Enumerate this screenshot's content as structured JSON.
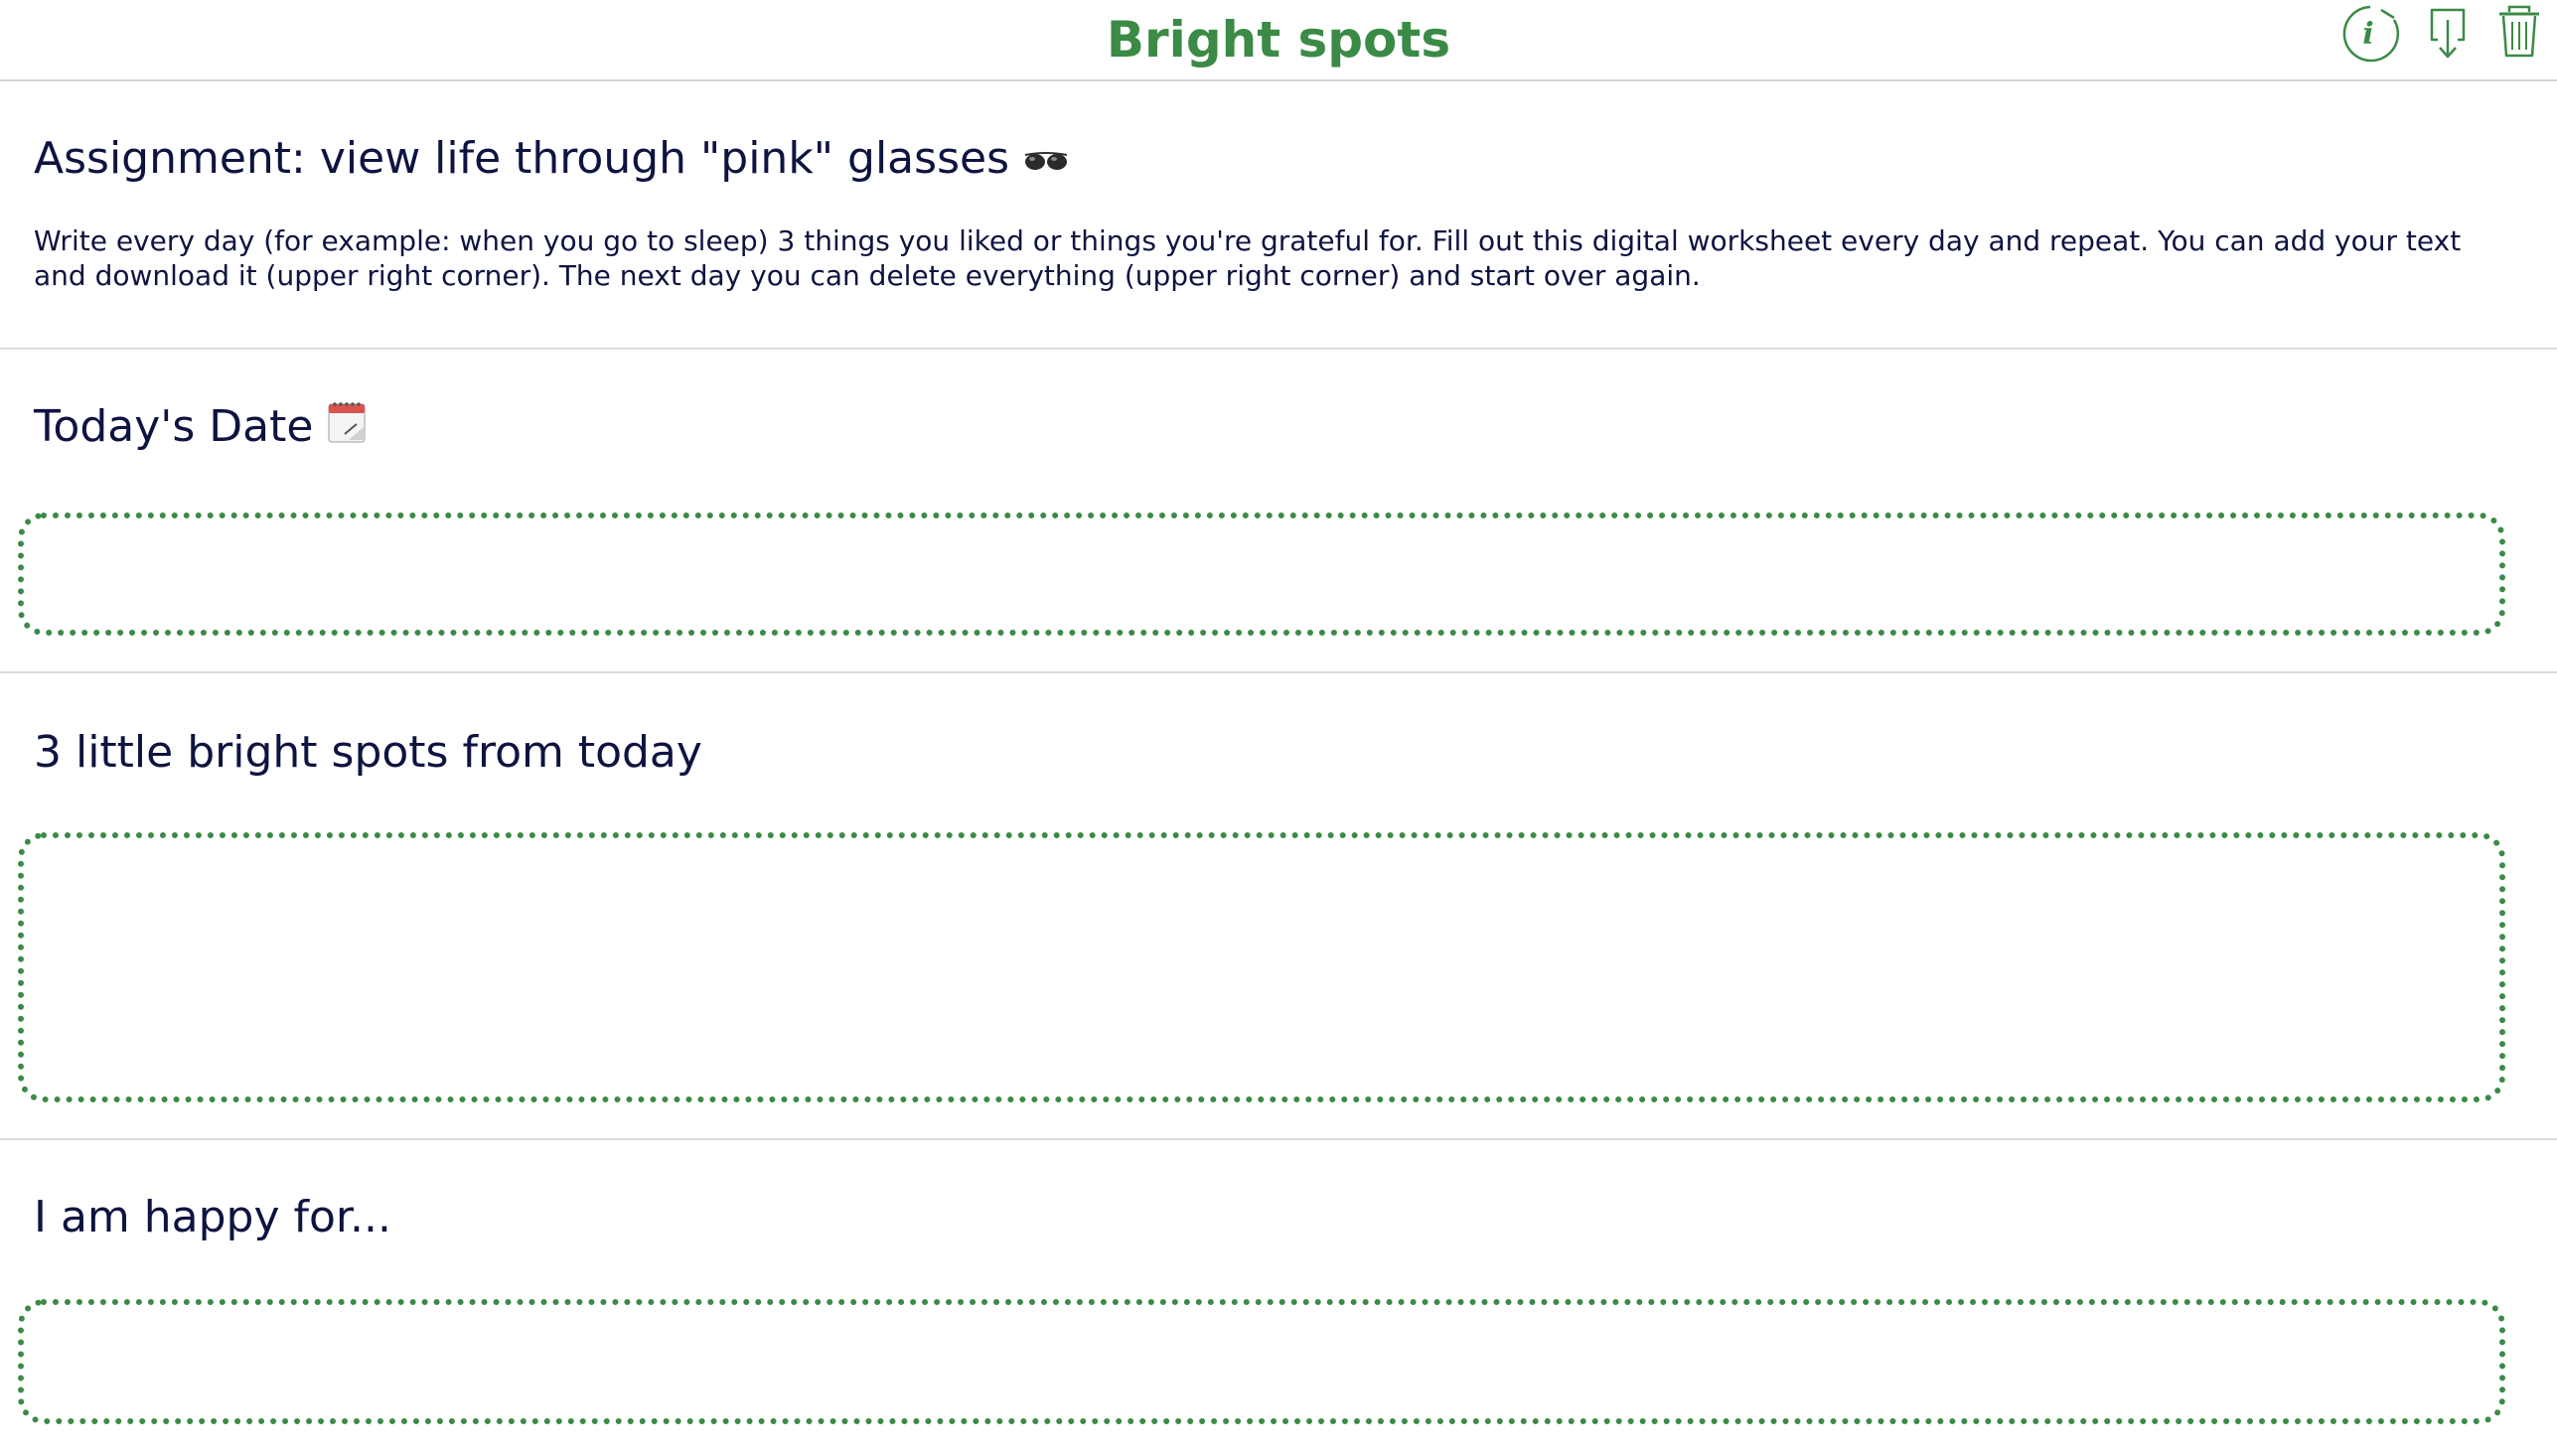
{
  "app": {
    "title": "Bright spots"
  },
  "toolbar": {
    "items": [
      {
        "name": "info",
        "icon": "info-icon"
      },
      {
        "name": "download",
        "icon": "download-icon"
      },
      {
        "name": "delete",
        "icon": "trash-icon"
      }
    ]
  },
  "assignment": {
    "heading": "Assignment: view life through \"pink\" glasses",
    "heading_icon": "sunglasses-icon",
    "text": "Write every day (for example: when you go to sleep) 3 things you liked or things you're grateful for. Fill out this digital worksheet every day and repeat. You can add your text and download it (upper right corner). The next day you can delete everything (upper right corner) and start over again."
  },
  "date_section": {
    "heading": "Today's Date",
    "heading_icon": "spiral-notepad-icon",
    "value": ""
  },
  "bright_spots_section": {
    "heading": "3 little bright spots from today",
    "value": ""
  },
  "happy_section": {
    "heading": "I am happy for...",
    "value": ""
  },
  "colors": {
    "accent": "#3b8a46",
    "text": "#0e1440",
    "divider": "#dcdcdc"
  }
}
